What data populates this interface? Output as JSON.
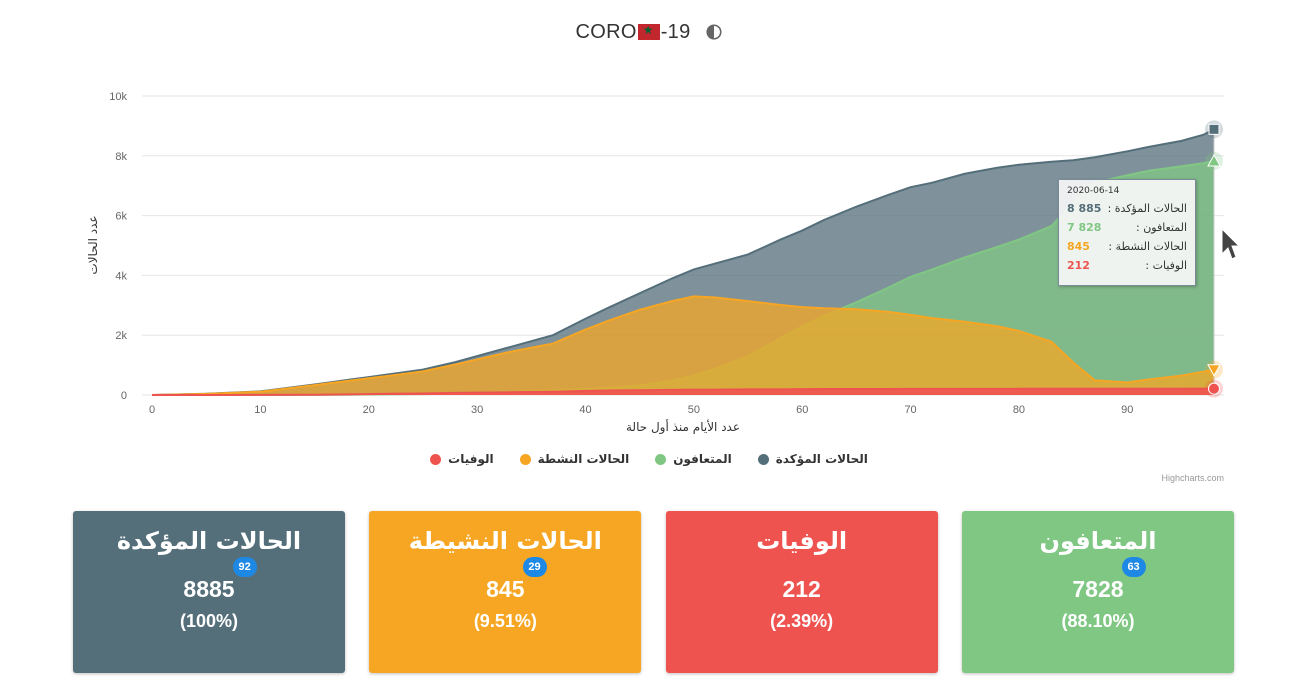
{
  "header": {
    "title_prefix": "CORO",
    "title_suffix": "-19",
    "flag_icon": "morocco-flag-icon",
    "theme_icon": "contrast-toggle-icon"
  },
  "chart_data": {
    "type": "area",
    "xlabel": "عدد الأيام منذ أول حالة",
    "ylabel": "عدد الحالات",
    "xlim": [
      0,
      98
    ],
    "ylim": [
      0,
      10000
    ],
    "x_ticks": [
      0,
      10,
      20,
      30,
      40,
      50,
      60,
      70,
      80,
      90
    ],
    "y_ticks": [
      0,
      2000,
      4000,
      6000,
      8000,
      10000
    ],
    "y_tick_labels": [
      "0",
      "2k",
      "4k",
      "6k",
      "8k",
      "10k"
    ],
    "grid": true,
    "legend_position": "bottom",
    "x": [
      0,
      5,
      10,
      15,
      18,
      20,
      22,
      25,
      28,
      30,
      33,
      35,
      37,
      40,
      42,
      45,
      48,
      50,
      52,
      55,
      58,
      60,
      62,
      65,
      68,
      70,
      72,
      75,
      78,
      80,
      83,
      85,
      87,
      90,
      92,
      95,
      97,
      98
    ],
    "series": [
      {
        "name": "الحالات المؤكدة",
        "color": "#546e7a",
        "values": [
          1,
          40,
          120,
          350,
          500,
          600,
          700,
          850,
          1100,
          1300,
          1600,
          1800,
          2000,
          2550,
          2900,
          3400,
          3900,
          4200,
          4400,
          4700,
          5200,
          5500,
          5850,
          6300,
          6700,
          6950,
          7100,
          7400,
          7600,
          7700,
          7800,
          7850,
          7950,
          8150,
          8300,
          8500,
          8700,
          8885
        ]
      },
      {
        "name": "المتعافون",
        "color": "#81c784",
        "values": [
          0,
          0,
          1,
          5,
          10,
          15,
          20,
          30,
          40,
          60,
          90,
          120,
          160,
          200,
          240,
          320,
          480,
          650,
          880,
          1300,
          1900,
          2300,
          2650,
          3100,
          3600,
          3950,
          4200,
          4600,
          4950,
          5200,
          5650,
          6400,
          7100,
          7350,
          7500,
          7650,
          7750,
          7828
        ]
      },
      {
        "name": "الحالات النشطة",
        "color": "#f6a623",
        "values": [
          1,
          38,
          110,
          330,
          470,
          560,
          650,
          790,
          1020,
          1190,
          1440,
          1580,
          1720,
          2190,
          2470,
          2850,
          3140,
          3300,
          3260,
          3140,
          3010,
          2940,
          2900,
          2870,
          2780,
          2680,
          2570,
          2450,
          2300,
          2140,
          1780,
          1090,
          490,
          420,
          520,
          650,
          780,
          845
        ]
      },
      {
        "name": "الوفيات",
        "color": "#ef5350",
        "values": [
          0,
          1,
          3,
          10,
          20,
          30,
          40,
          50,
          70,
          80,
          90,
          100,
          110,
          140,
          150,
          160,
          170,
          180,
          180,
          190,
          190,
          195,
          200,
          200,
          200,
          205,
          205,
          206,
          206,
          207,
          208,
          208,
          209,
          210,
          210,
          211,
          212,
          212
        ]
      }
    ]
  },
  "legend": [
    {
      "label": "الحالات المؤكدة",
      "color": "#546e7a"
    },
    {
      "label": "المتعافون",
      "color": "#81c784"
    },
    {
      "label": "الحالات النشطة",
      "color": "#f6a623"
    },
    {
      "label": "الوفيات",
      "color": "#ef5350"
    }
  ],
  "credits": "Highcharts.com",
  "tooltip": {
    "date": "2020-06-14",
    "rows": [
      {
        "label": "الحالات المؤكدة :",
        "value": "8 885",
        "color": "#546e7a"
      },
      {
        "label": "المتعافون :",
        "value": "7 828",
        "color": "#81c784"
      },
      {
        "label": "الحالات النشطة :",
        "value": "845",
        "color": "#f6a623"
      },
      {
        "label": "الوفيات :",
        "value": "212",
        "color": "#ef5350"
      }
    ]
  },
  "cards": [
    {
      "title": "الحالات المؤكدة",
      "value": "8885",
      "badge": "92",
      "percent": "(100%)",
      "color": "#546e7a"
    },
    {
      "title": "الحالات النشيطة",
      "value": "845",
      "badge": "29",
      "percent": "(9.51%)",
      "color": "#f6a623"
    },
    {
      "title": "الوفيات",
      "value": "212",
      "badge": "",
      "percent": "(2.39%)",
      "color": "#ef5350"
    },
    {
      "title": "المتعافون",
      "value": "7828",
      "badge": "63",
      "percent": "(88.10%)",
      "color": "#81c784"
    }
  ]
}
